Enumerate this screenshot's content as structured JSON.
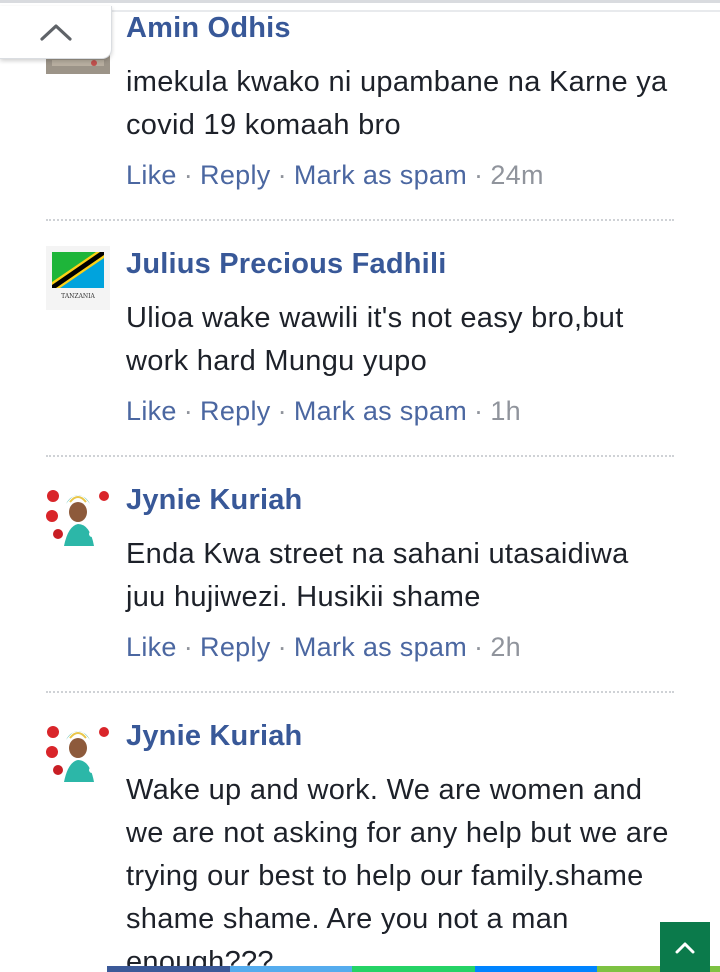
{
  "comments": [
    {
      "name": "Amin Odhis",
      "text": "imekula kwako ni upambane na Karne ya covid 19 komaah bro",
      "like": "Like",
      "reply": "Reply",
      "spam": "Mark as spam",
      "time": "24m"
    },
    {
      "name": "Julius Precious Fadhili",
      "text": "Ulioa wake wawili it's not easy bro,but work hard Mungu yupo",
      "like": "Like",
      "reply": "Reply",
      "spam": "Mark as spam",
      "time": "1h",
      "avatar_caption": "TANZANIA"
    },
    {
      "name": "Jynie Kuriah",
      "text": "Enda Kwa street na sahani utasaidiwa juu hujiwezi. Husikii shame",
      "like": "Like",
      "reply": "Reply",
      "spam": "Mark as spam",
      "time": "2h"
    },
    {
      "name": "Jynie Kuriah",
      "text": "Wake up and work. We are women and we are not asking for any help but we are trying our best to help our family.shame shame shame. Are you not a man enough???"
    }
  ],
  "separator": "·",
  "colors": {
    "name_blue": "#385898",
    "link_blue": "#4b67a1",
    "meta_grey": "#90949c",
    "scroll_button": "#0b7a4b",
    "share_facebook": "#3b5998",
    "share_twitter": "#55acee",
    "share_whatsapp": "#25d366",
    "share_messenger": "#0084ff",
    "share_sms": "#7dc242"
  },
  "icons": {
    "collapse": "chevron-up-icon",
    "scroll_top": "arrow-up-icon"
  }
}
